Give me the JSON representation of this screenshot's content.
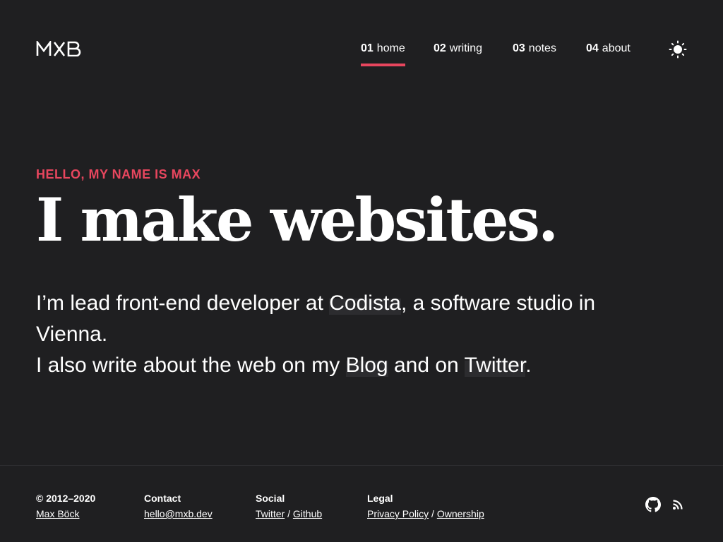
{
  "header": {
    "logo_text": "MXB",
    "nav": [
      {
        "num": "01",
        "label": "home",
        "active": true
      },
      {
        "num": "02",
        "label": "writing",
        "active": false
      },
      {
        "num": "03",
        "label": "notes",
        "active": false
      },
      {
        "num": "04",
        "label": "about",
        "active": false
      }
    ],
    "theme_toggle_icon": "sun-icon"
  },
  "hero": {
    "eyebrow": "HELLO, MY NAME IS MAX",
    "headline": "I make websites.",
    "intro_pre": "I’m lead front-end developer at ",
    "intro_link_codista": "Codista",
    "intro_mid": ", a software studio in Vienna.",
    "intro_line2_pre": "I also write about the web on my ",
    "intro_link_blog": "Blog",
    "intro_line2_mid": " and on ",
    "intro_link_twitter": "Twitter",
    "intro_line2_end": "."
  },
  "footer": {
    "copyright": {
      "head": "© 2012–2020",
      "link": "Max Böck"
    },
    "contact": {
      "head": "Contact",
      "link": "hello@mxb.dev"
    },
    "social": {
      "head": "Social",
      "link1": "Twitter",
      "sep": "/",
      "link2": "Github"
    },
    "legal": {
      "head": "Legal",
      "link1": "Privacy Policy",
      "sep": "/",
      "link2": "Ownership"
    },
    "icons": [
      "github-icon",
      "rss-icon"
    ]
  },
  "colors": {
    "background": "#1f1f21",
    "accent": "#e8465e",
    "text": "#ffffff"
  }
}
